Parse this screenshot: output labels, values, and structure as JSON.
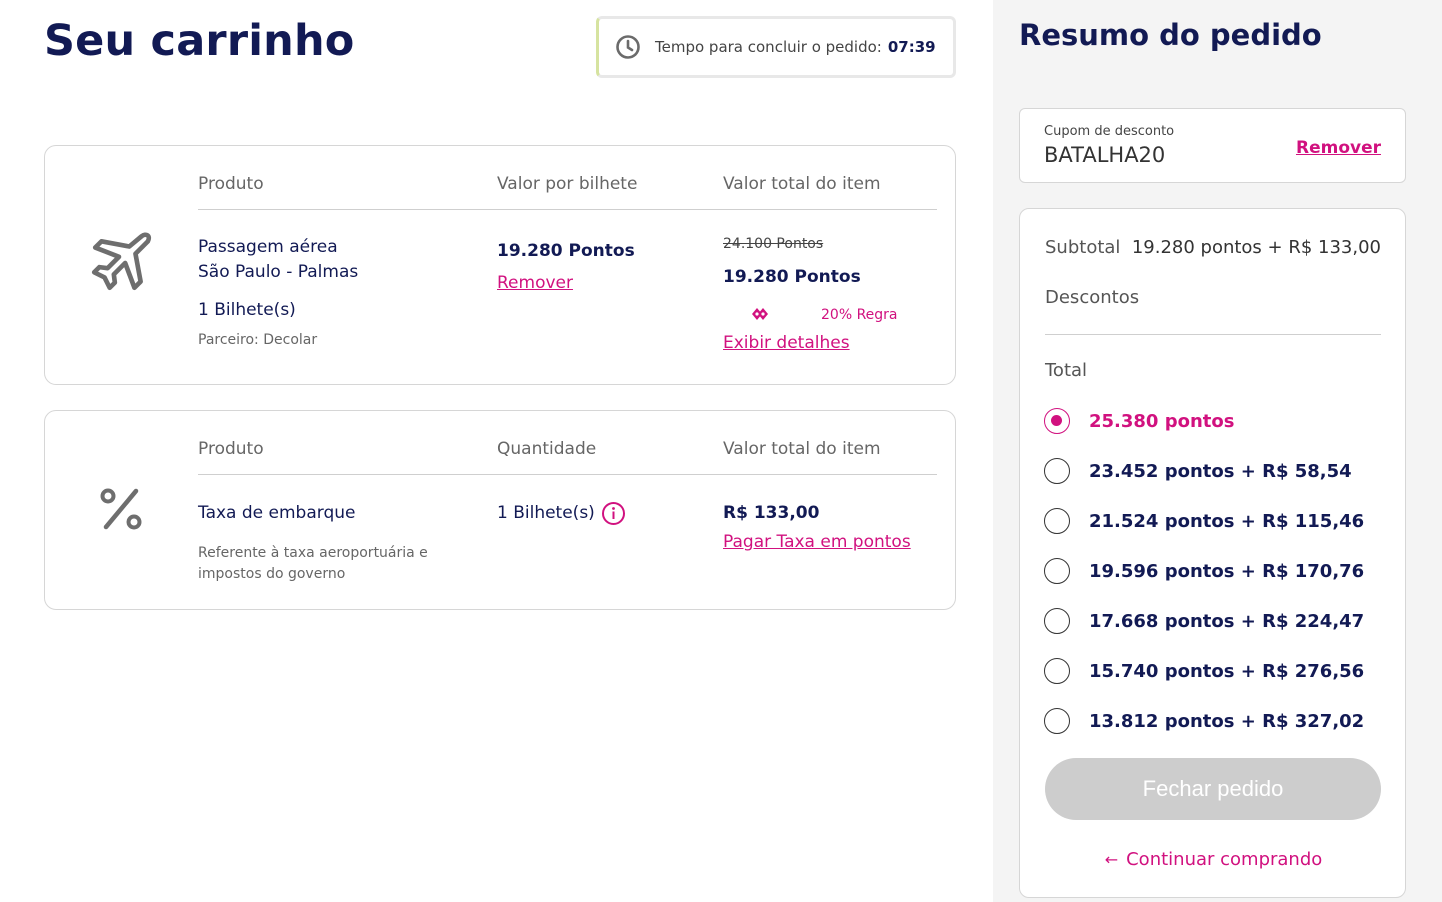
{
  "page": {
    "title": "Seu carrinho"
  },
  "timer": {
    "label": "Tempo para concluir o pedido:",
    "value": "07:39"
  },
  "items": [
    {
      "icon": "airplane-icon",
      "headers": [
        "Produto",
        "Valor por bilhete",
        "Valor total do item"
      ],
      "name_line1": "Passagem aérea",
      "name_line2": "São Paulo - Palmas",
      "quantity": "1 Bilhete(s)",
      "partner": "Parceiro: Decolar",
      "unit_price": "19.280 Pontos",
      "remove_label": "Remover",
      "old_total": "24.100 Pontos",
      "total": "19.280 Pontos",
      "discount_rule": "20% Regra",
      "details_label": "Exibir detalhes"
    },
    {
      "icon": "percent-icon",
      "headers": [
        "Produto",
        "Quantidade",
        "Valor total do item"
      ],
      "name": "Taxa de embarque",
      "desc_line1": "Referente à taxa aeroportuária e",
      "desc_line2": "impostos do governo",
      "quantity": "1 Bilhete(s)",
      "total": "R$ 133,00",
      "pay_points_label": "Pagar Taxa em pontos"
    }
  ],
  "summary": {
    "title": "Resumo do pedido",
    "coupon": {
      "label": "Cupom de desconto",
      "code": "BATALHA20",
      "remove_label": "Remover"
    },
    "subtotal_label": "Subtotal",
    "subtotal_value": "19.280 pontos + R$ 133,00",
    "discounts_label": "Descontos",
    "total_label": "Total",
    "options": [
      {
        "label": "25.380 pontos",
        "selected": true
      },
      {
        "label": "23.452 pontos + R$ 58,54",
        "selected": false
      },
      {
        "label": "21.524 pontos + R$ 115,46",
        "selected": false
      },
      {
        "label": "19.596 pontos + R$ 170,76",
        "selected": false
      },
      {
        "label": "17.668 pontos + R$ 224,47",
        "selected": false
      },
      {
        "label": "15.740 pontos + R$ 276,56",
        "selected": false
      },
      {
        "label": "13.812 pontos + R$ 327,02",
        "selected": false
      }
    ],
    "close_button": "Fechar pedido",
    "continue_label": "Continuar comprando"
  },
  "colors": {
    "brand_navy": "#121a54",
    "accent_pink": "#d1117f",
    "disabled_grey": "#cdcdcd"
  }
}
